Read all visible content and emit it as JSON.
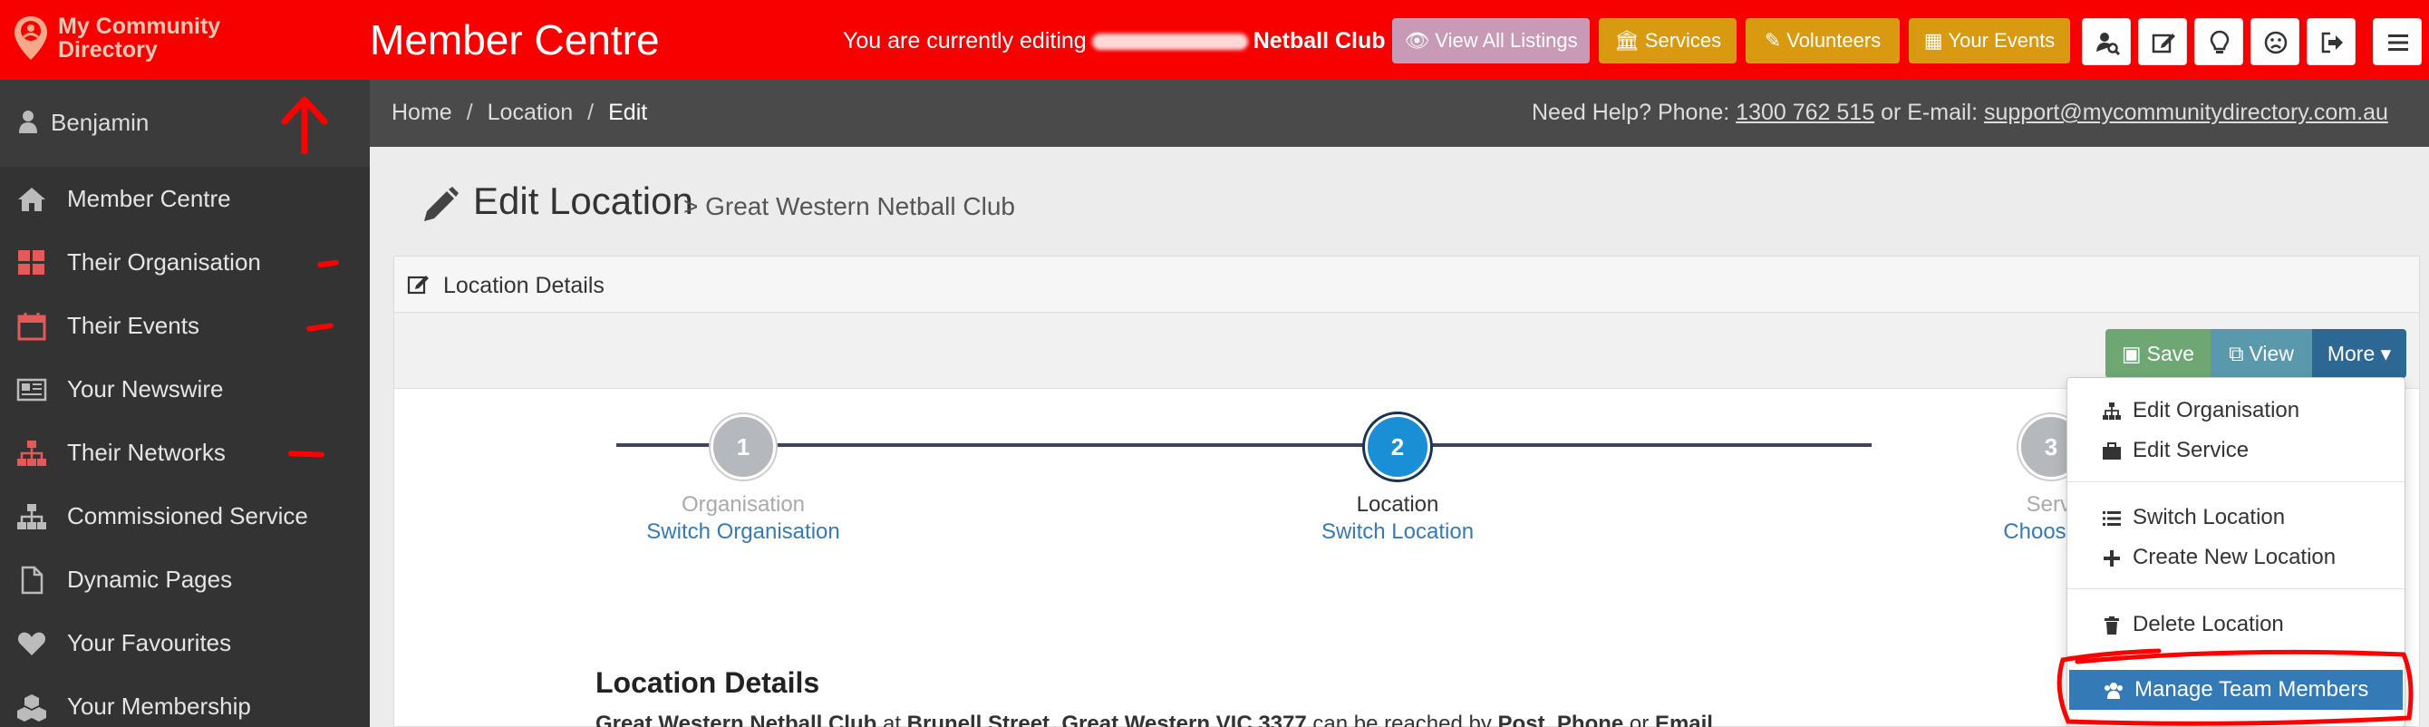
{
  "brand": {
    "logo_line1": "My Community",
    "logo_line2": "Directory",
    "app_title": "Member Centre"
  },
  "header": {
    "editing_prefix": "You are currently editing",
    "editing_org": "Netball Club",
    "buttons": {
      "listings": "View All Listings",
      "services": "Services",
      "volunteers": "Volunteers",
      "events": "Your Events"
    },
    "icon_buttons": [
      "search-user-icon",
      "edit-icon",
      "lightbulb-icon",
      "frown-icon",
      "sign-out-icon",
      "menu-icon"
    ]
  },
  "sidebar": {
    "user": "Benjamin",
    "items": [
      {
        "label": "Member Centre",
        "icon": "home-icon"
      },
      {
        "label": "Their Organisation",
        "icon": "grid-icon"
      },
      {
        "label": "Their Events",
        "icon": "calendar-icon"
      },
      {
        "label": "Your Newswire",
        "icon": "newspaper-icon"
      },
      {
        "label": "Their Networks",
        "icon": "sitemap-icon"
      },
      {
        "label": "Commissioned Service",
        "icon": "sitemap-icon"
      },
      {
        "label": "Dynamic Pages",
        "icon": "file-icon"
      },
      {
        "label": "Your Favourites",
        "icon": "heart-icon"
      },
      {
        "label": "Your Membership",
        "icon": "cubes-icon"
      }
    ]
  },
  "breadcrumb": {
    "home": "Home",
    "location": "Location",
    "current": "Edit"
  },
  "help": {
    "prefix": "Need Help? Phone:",
    "phone": "1300 762 515",
    "middle": "or E-mail:",
    "email": "support@mycommunitydirectory.com.au"
  },
  "page": {
    "title": "Edit Location",
    "subtitle": "> Great Western Netball Club"
  },
  "panel": {
    "title": "Location Details"
  },
  "actions": {
    "save": "Save",
    "view": "View",
    "more": "More"
  },
  "stepper": [
    {
      "number": "1",
      "label": "Organisation",
      "link": "Switch Organisation"
    },
    {
      "number": "2",
      "label": "Location",
      "link": "Switch Location"
    },
    {
      "number": "3",
      "label": "Servi",
      "link": "Choose S"
    }
  ],
  "details": {
    "title": "Location Details",
    "org": "Great Western Netball Club",
    "at": "at",
    "address": "Brunell Street, Great Western VIC 3377",
    "reached": "can be reached by",
    "post": "Post",
    "phone": "Phone",
    "or": "or",
    "email": "Email"
  },
  "more_menu": {
    "items": [
      {
        "label": "Edit Organisation",
        "icon": "sitemap-icon"
      },
      {
        "label": "Edit Service",
        "icon": "briefcase-icon"
      },
      {
        "label": "Switch Location",
        "icon": "list-icon"
      },
      {
        "label": "Create New Location",
        "icon": "plus-icon"
      },
      {
        "label": "Delete Location",
        "icon": "trash-icon"
      },
      {
        "label": "Manage Team Members",
        "icon": "users-icon"
      }
    ]
  },
  "colors": {
    "topbar": "#f80000",
    "sidebar": "#333333",
    "accent": "#337ab7",
    "step_active": "#1a8fd6",
    "step_inactive": "#b5b8bd"
  }
}
